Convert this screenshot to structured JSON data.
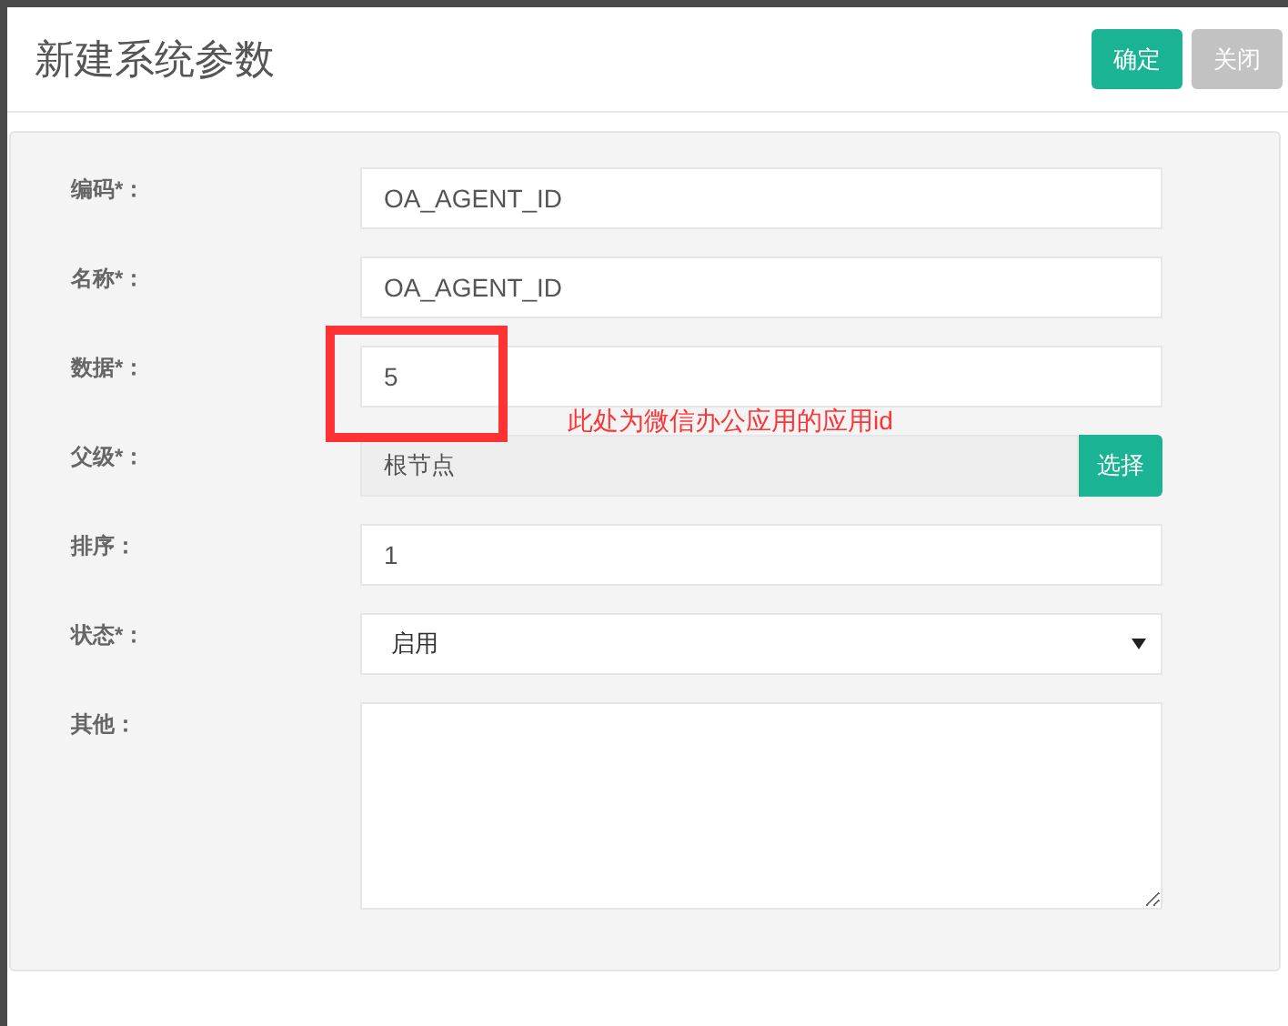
{
  "dialog": {
    "title": "新建系统参数",
    "buttons": [
      {
        "label": "确定",
        "kind": "primary"
      },
      {
        "label": "关闭",
        "kind": "secondary"
      }
    ]
  },
  "fields": [
    {
      "label": "编码*：",
      "kind": "text",
      "value": "OA_AGENT_ID"
    },
    {
      "label": "名称*：",
      "kind": "text",
      "value": "OA_AGENT_ID"
    },
    {
      "label": "数据*：",
      "kind": "text",
      "value": "5"
    },
    {
      "label": "父级*：",
      "kind": "picker",
      "value": "根节点",
      "button": "选择"
    },
    {
      "label": "排序：",
      "kind": "text",
      "value": "1"
    },
    {
      "label": "状态*：",
      "kind": "select",
      "value": "启用"
    },
    {
      "label": "其他：",
      "kind": "textarea"
    }
  ],
  "annotation": {
    "note": "此处为微信办公应用的应用id"
  }
}
